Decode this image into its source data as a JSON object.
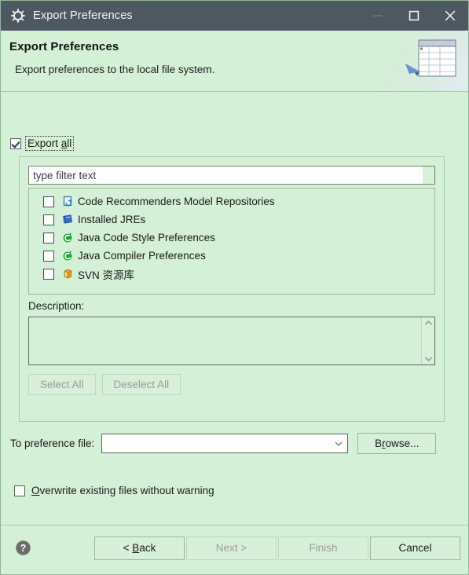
{
  "window": {
    "title": "Export Preferences",
    "icon": "gear-icon",
    "controls": {
      "minimize": "minimize-icon",
      "maximize": "maximize-icon",
      "close": "close-icon"
    }
  },
  "banner": {
    "title": "Export Preferences",
    "subtitle": "Export preferences to the local file system.",
    "graphic": "export-preferences-banner-icon"
  },
  "export_all": {
    "label_before": "Export ",
    "label_mnemonic": "a",
    "label_after": "ll",
    "checked": true,
    "focused": true
  },
  "filter": {
    "placeholder": "type filter text",
    "value": ""
  },
  "tree": {
    "items": [
      {
        "label": "Code Recommenders Model Repositories",
        "icon": "code-recommenders-icon",
        "checked": false
      },
      {
        "label": "Installed JREs",
        "icon": "jre-book-icon",
        "checked": false
      },
      {
        "label": "Java Code Style Preferences",
        "icon": "java-preferences-icon",
        "checked": false
      },
      {
        "label": "Java Compiler Preferences",
        "icon": "java-preferences-icon",
        "checked": false
      },
      {
        "label": "SVN 资源库",
        "icon": "svn-repository-icon",
        "checked": false
      }
    ]
  },
  "description": {
    "label": "Description:",
    "value": "",
    "scroll_up": "scroll-up-icon",
    "scroll_down": "scroll-down-icon"
  },
  "selection_buttons": {
    "select_all": "Select All",
    "deselect_all": "Deselect All",
    "select_all_enabled": false,
    "deselect_all_enabled": false
  },
  "preference_file": {
    "label": "To preference file:",
    "value": "",
    "dropdown_icon": "chevron-down-icon",
    "browse_before": "B",
    "browse_mnemonic": "r",
    "browse_after": "owse..."
  },
  "overwrite": {
    "mnemonic": "O",
    "label_after": "verwrite existing files without warning",
    "checked": false
  },
  "footer": {
    "help_icon": "help-icon",
    "back_before": "< ",
    "back_mnemonic": "B",
    "back_after": "ack",
    "next": "Next >",
    "finish": "Finish",
    "cancel": "Cancel",
    "back_enabled": true,
    "next_enabled": false,
    "finish_enabled": false,
    "cancel_enabled": true
  },
  "colors": {
    "titlebar": "#4e5861",
    "background": "#d4f0d6",
    "accent_blue": "#2b5ea8",
    "java_green": "#15a01e"
  }
}
